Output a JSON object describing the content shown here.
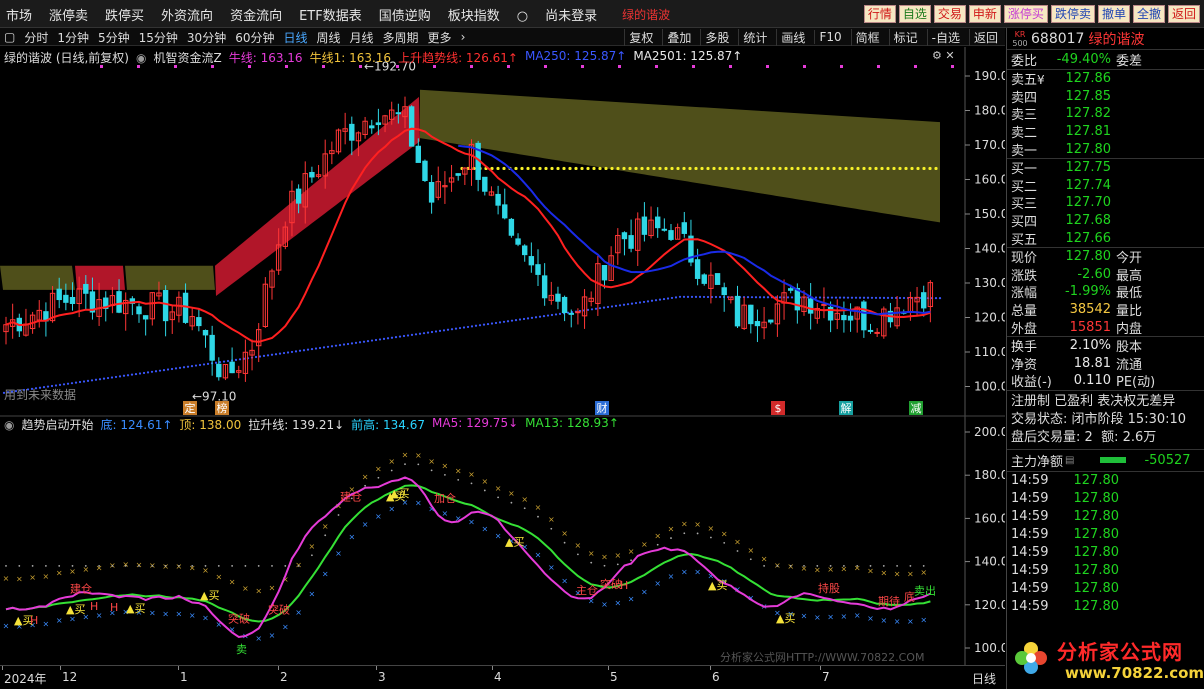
{
  "menu": {
    "items": [
      "市场",
      "涨停卖",
      "跌停买",
      "外资流向",
      "资金流向",
      "ETF数据表",
      "国债逆购",
      "板块指数"
    ],
    "login_status": "尚未登录",
    "current_stock": "绿的谐波"
  },
  "quick_buttons": [
    {
      "label": "行情",
      "color": "r"
    },
    {
      "label": "自选",
      "color": "g"
    },
    {
      "label": "交易",
      "color": "r"
    },
    {
      "label": "申新",
      "color": "r"
    },
    {
      "label": "涨停买",
      "color": "m"
    },
    {
      "label": "跌停卖",
      "color": "b"
    },
    {
      "label": "撤单",
      "color": "b"
    },
    {
      "label": "全撤",
      "color": "b"
    },
    {
      "label": "返回",
      "color": "r"
    }
  ],
  "periodbar": {
    "left": [
      "分时",
      "1分钟",
      "5分钟",
      "15分钟",
      "30分钟",
      "60分钟",
      "日线",
      "周线",
      "月线",
      "多周期",
      "更多"
    ],
    "selected": "日线",
    "right": [
      "复权",
      "叠加",
      "多股",
      "统计",
      "画线",
      "F10",
      "简框",
      "标记",
      "-自选",
      "返回"
    ]
  },
  "main_chart": {
    "title": "绿的谐波 (日线,前复权)",
    "indicator": "机智资金流Z",
    "legend": [
      {
        "text": "牛线: 163.16",
        "color": "#e53bd8"
      },
      {
        "text": "牛线1: 163.16",
        "color": "#f0c33c"
      },
      {
        "text": "上升趋势线: 126.61↑",
        "color": "#ff3030"
      },
      {
        "text": "MA250: 125.87↑",
        "color": "#3a57ff"
      },
      {
        "text": "MA2501: 125.87↑",
        "color": "#e8e8e8"
      }
    ],
    "y_ticks": [
      "190.0",
      "180.0",
      "170.0",
      "160.0",
      "150.0",
      "140.0",
      "130.0",
      "120.0",
      "110.0",
      "100.0"
    ],
    "high_label": "192.70",
    "low_label": "97.10",
    "future_label": "用到未来数据",
    "event_markers": [
      {
        "label": "定",
        "bg": "#c97d29"
      },
      {
        "label": "榜",
        "bg": "#c97d29"
      },
      {
        "label": "财",
        "bg": "#2b6dd6"
      },
      {
        "label": "$",
        "bg": "#d22a2a"
      },
      {
        "label": "解",
        "bg": "#16a0a0"
      },
      {
        "label": "减",
        "bg": "#20a030"
      }
    ],
    "ma": {
      "ma_red": "上升趋势线",
      "ma_blue": "MA250"
    }
  },
  "sub_chart": {
    "title": "趋势启动开始",
    "legend": [
      {
        "text": "底: 124.61↑",
        "color": "#3a8cff"
      },
      {
        "text": "顶: 138.00",
        "color": "#f0c33c"
      },
      {
        "text": "拉升线: 139.21↓",
        "color": "#e0e0e0"
      },
      {
        "text": "前高: 134.67",
        "color": "#2ad4ff"
      },
      {
        "text": "MA5: 129.75↓",
        "color": "#e53bd8"
      },
      {
        "text": "MA13: 128.93↑",
        "color": "#35e035"
      }
    ],
    "y_ticks": [
      "200.0",
      "180.0",
      "160.0",
      "140.0",
      "120.0",
      "100.0"
    ],
    "watermark": "分析家公式网HTTP://WWW.70822.COM",
    "signals": [
      "买",
      "买",
      "买",
      "买",
      "买",
      "买",
      "买",
      "买",
      "买",
      "卖",
      "突破",
      "突破",
      "突破",
      "建仓",
      "建仓",
      "加仓",
      "持股",
      "主仓",
      "期待",
      "底",
      "卖出",
      "H",
      "H",
      "H",
      "H"
    ]
  },
  "x_axis": {
    "labels": [
      "2024年",
      "12",
      "1",
      "2",
      "3",
      "4",
      "5",
      "6",
      "7"
    ],
    "period": "日线"
  },
  "panel": {
    "badge_top": "KR",
    "badge_bottom": "500",
    "code": "688017",
    "name": "绿的谐波",
    "weibi_label": "委比",
    "weibi_value": "-49.40%",
    "weicha_label": "委差",
    "asks": [
      {
        "label": "卖五",
        "currency": "¥",
        "price": "127.86"
      },
      {
        "label": "卖四",
        "currency": "",
        "price": "127.85"
      },
      {
        "label": "卖三",
        "currency": "",
        "price": "127.82"
      },
      {
        "label": "卖二",
        "currency": "",
        "price": "127.81"
      },
      {
        "label": "卖一",
        "currency": "",
        "price": "127.80"
      }
    ],
    "bids": [
      {
        "label": "买一",
        "price": "127.75"
      },
      {
        "label": "买二",
        "price": "127.74"
      },
      {
        "label": "买三",
        "price": "127.70"
      },
      {
        "label": "买四",
        "price": "127.68"
      },
      {
        "label": "买五",
        "price": "127.66"
      }
    ],
    "stats": [
      {
        "l1": "现价",
        "v1": "127.80",
        "c": "g",
        "l2": "今开"
      },
      {
        "l1": "涨跌",
        "v1": "-2.60",
        "c": "g",
        "l2": "最高"
      },
      {
        "l1": "涨幅",
        "v1": "-1.99%",
        "c": "g",
        "l2": "最低"
      },
      {
        "l1": "总量",
        "v1": "38542",
        "c": "ye",
        "l2": "量比"
      },
      {
        "l1": "外盘",
        "v1": "15851",
        "c": "rd",
        "l2": "内盘"
      }
    ],
    "stats2": [
      {
        "l1": "换手",
        "v1": "2.10%",
        "l2": "股本"
      },
      {
        "l1": "净资",
        "v1": "18.81",
        "l2": "流通"
      },
      {
        "l1": "收益(-)",
        "v1": "0.110",
        "l2": "PE(动)"
      }
    ],
    "tags": "注册制 已盈利 表决权无差异",
    "trade_status_label": "交易状态:",
    "trade_status_value": "闭市阶段 15:30:10",
    "after_hours_label": "盘后交易量:",
    "after_hours_value": "2",
    "amount_label": "额:",
    "amount_value": "2.6万",
    "net_flow_label": "主力净额",
    "net_flow_value": "-50527",
    "ticks": [
      {
        "time": "14:59",
        "price": "127.80"
      },
      {
        "time": "14:59",
        "price": "127.80"
      },
      {
        "time": "14:59",
        "price": "127.80"
      },
      {
        "time": "14:59",
        "price": "127.80"
      },
      {
        "time": "14:59",
        "price": "127.80"
      },
      {
        "time": "14:59",
        "price": "127.80"
      },
      {
        "time": "14:59",
        "price": "127.80"
      },
      {
        "time": "14:59",
        "price": "127.80"
      }
    ],
    "logo_text": "分析家公式网",
    "logo_url": "www.70822.com"
  },
  "colors": {
    "up": "#ff3636",
    "down": "#2fd7e6",
    "bull_band": "#d01a30",
    "bear_band": "#5d5d1e",
    "ma_red": "#ff2020",
    "ma_blue": "#1a2be8",
    "resistance": "#f5f029"
  }
}
